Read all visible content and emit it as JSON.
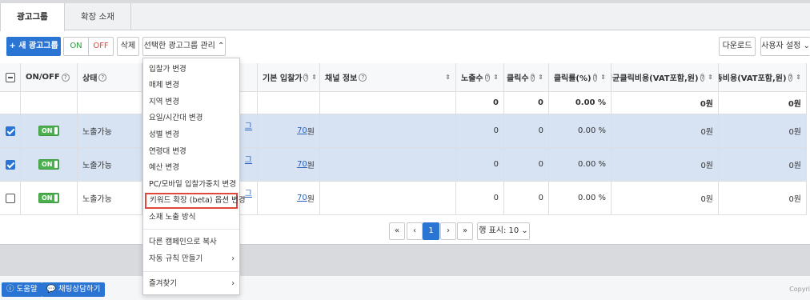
{
  "tabs": [
    "광고그룹",
    "확장 소재"
  ],
  "toolbar": {
    "new_group": "+ 새 광고그룹",
    "on": "ON",
    "off": "OFF",
    "delete": "삭제",
    "manage": "선택한 광고그룹 관리 ⌃",
    "download": "다운로드",
    "user_settings": "사용자 설정 ⌄"
  },
  "table": {
    "headers": {
      "onoff": "ON/OFF",
      "status": "상태",
      "bid": "기본 입찰가",
      "channel": "채널 정보",
      "impressions": "노출수",
      "clicks": "클릭수",
      "ctr": "클릭률(%)",
      "avg_cpc": "평균클릭비용(VAT포함,원)",
      "total_cost": "총비용(VAT포함,원)"
    },
    "summary": {
      "impressions": "0",
      "clicks": "0",
      "ctr": "0.00 %",
      "avg_cpc": "0원",
      "total_cost": "0원"
    },
    "rows": [
      {
        "toggle": "ON",
        "status": "노출가능",
        "bid": "70",
        "bid_unit": "원",
        "impressions": "0",
        "clicks": "0",
        "ctr": "0.00 %",
        "avg_cpc": "0원",
        "total_cost": "0원"
      },
      {
        "toggle": "ON",
        "status": "노출가능",
        "bid": "70",
        "bid_unit": "원",
        "impressions": "0",
        "clicks": "0",
        "ctr": "0.00 %",
        "avg_cpc": "0원",
        "total_cost": "0원"
      },
      {
        "toggle": "ON",
        "status": "노출가능",
        "bid": "70",
        "bid_unit": "원",
        "impressions": "0",
        "clicks": "0",
        "ctr": "0.00 %",
        "avg_cpc": "0원",
        "total_cost": "0원"
      }
    ],
    "name_fragment": "그"
  },
  "pagination": {
    "first": "«",
    "prev": "‹",
    "current": "1",
    "next": "›",
    "last": "»",
    "rows_label": "행 표시: 10 ⌄"
  },
  "menu": {
    "items": [
      "입찰가 변경",
      "매체 변경",
      "지역 변경",
      "요일/시간대 변경",
      "성별 변경",
      "연령대 변경",
      "예산 변경",
      "PC/모바일 입찰가중치 변경",
      "키워드 확장 (beta) 옵션 변경",
      "소재 노출 방식"
    ],
    "copy": "다른 캠페인으로 복사",
    "auto_rule": "자동 규칙 만들기",
    "favorites": "즐겨찾기",
    "arrow": "›"
  },
  "footer": {
    "help": "도움말",
    "chat": "채팅상담하기",
    "copyright": "Copyri"
  },
  "colors": {
    "accent": "#2a74d4",
    "highlight": "#e0483e",
    "selected_row": "#d7e3f3"
  }
}
